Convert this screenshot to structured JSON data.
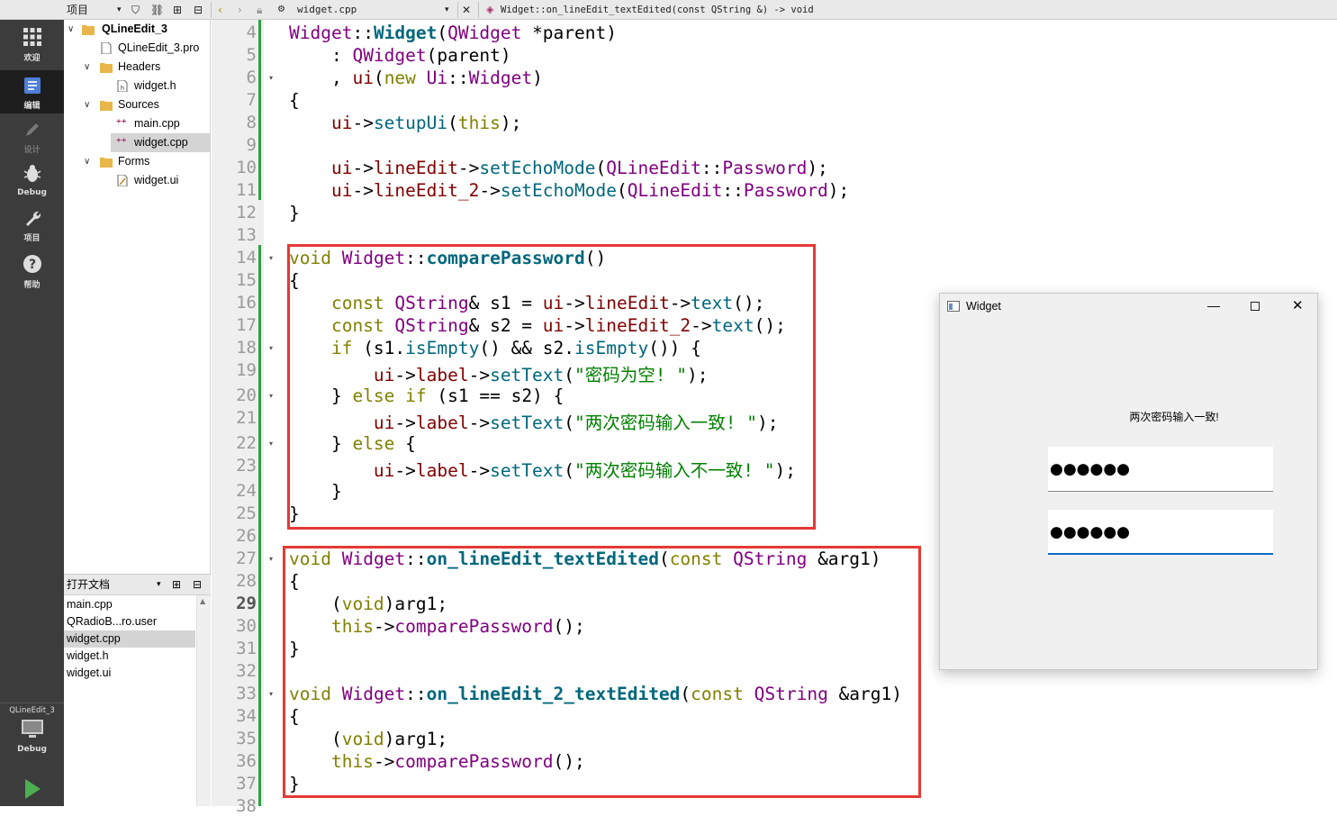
{
  "toolbar": {
    "project_label": "项目",
    "file_name": "widget.cpp",
    "function_signature": "Widget::on_lineEdit_textEdited(const QString &) -> void"
  },
  "modes": [
    {
      "label": "欢迎",
      "icon": "grid-icon"
    },
    {
      "label": "编辑",
      "icon": "document-icon"
    },
    {
      "label": "设计",
      "icon": "pencil-icon"
    },
    {
      "label": "Debug",
      "icon": "bug-icon"
    },
    {
      "label": "项目",
      "icon": "wrench-icon"
    },
    {
      "label": "帮助",
      "icon": "help-icon"
    }
  ],
  "kit": {
    "project": "QLineEdit_3",
    "build": "Debug"
  },
  "tree": {
    "project": "QLineEdit_3",
    "pro_file": "QLineEdit_3.pro",
    "headers": "Headers",
    "header_file": "widget.h",
    "sources": "Sources",
    "source_main": "main.cpp",
    "source_widget": "widget.cpp",
    "forms": "Forms",
    "form_file": "widget.ui"
  },
  "open_docs": {
    "title": "打开文档",
    "items": [
      "main.cpp",
      "QRadioB...ro.user",
      "widget.cpp",
      "widget.h",
      "widget.ui"
    ]
  },
  "line_numbers": [
    "4",
    "5",
    "6",
    "7",
    "8",
    "9",
    "10",
    "11",
    "12",
    "13",
    "14",
    "15",
    "16",
    "17",
    "18",
    "19",
    "20",
    "21",
    "22",
    "23",
    "24",
    "25",
    "26",
    "27",
    "28",
    "29",
    "30",
    "31",
    "32",
    "33",
    "34",
    "35",
    "36",
    "37",
    "38"
  ],
  "current_line": "29",
  "strings": {
    "empty": "\"密码为空! \"",
    "match": "\"两次密码输入一致! \"",
    "mismatch": "\"两次密码输入不一致! \""
  },
  "window": {
    "title": "Widget",
    "label": "两次密码输入一致!",
    "password1": "●●●●●●",
    "password2": "●●●●●●"
  }
}
